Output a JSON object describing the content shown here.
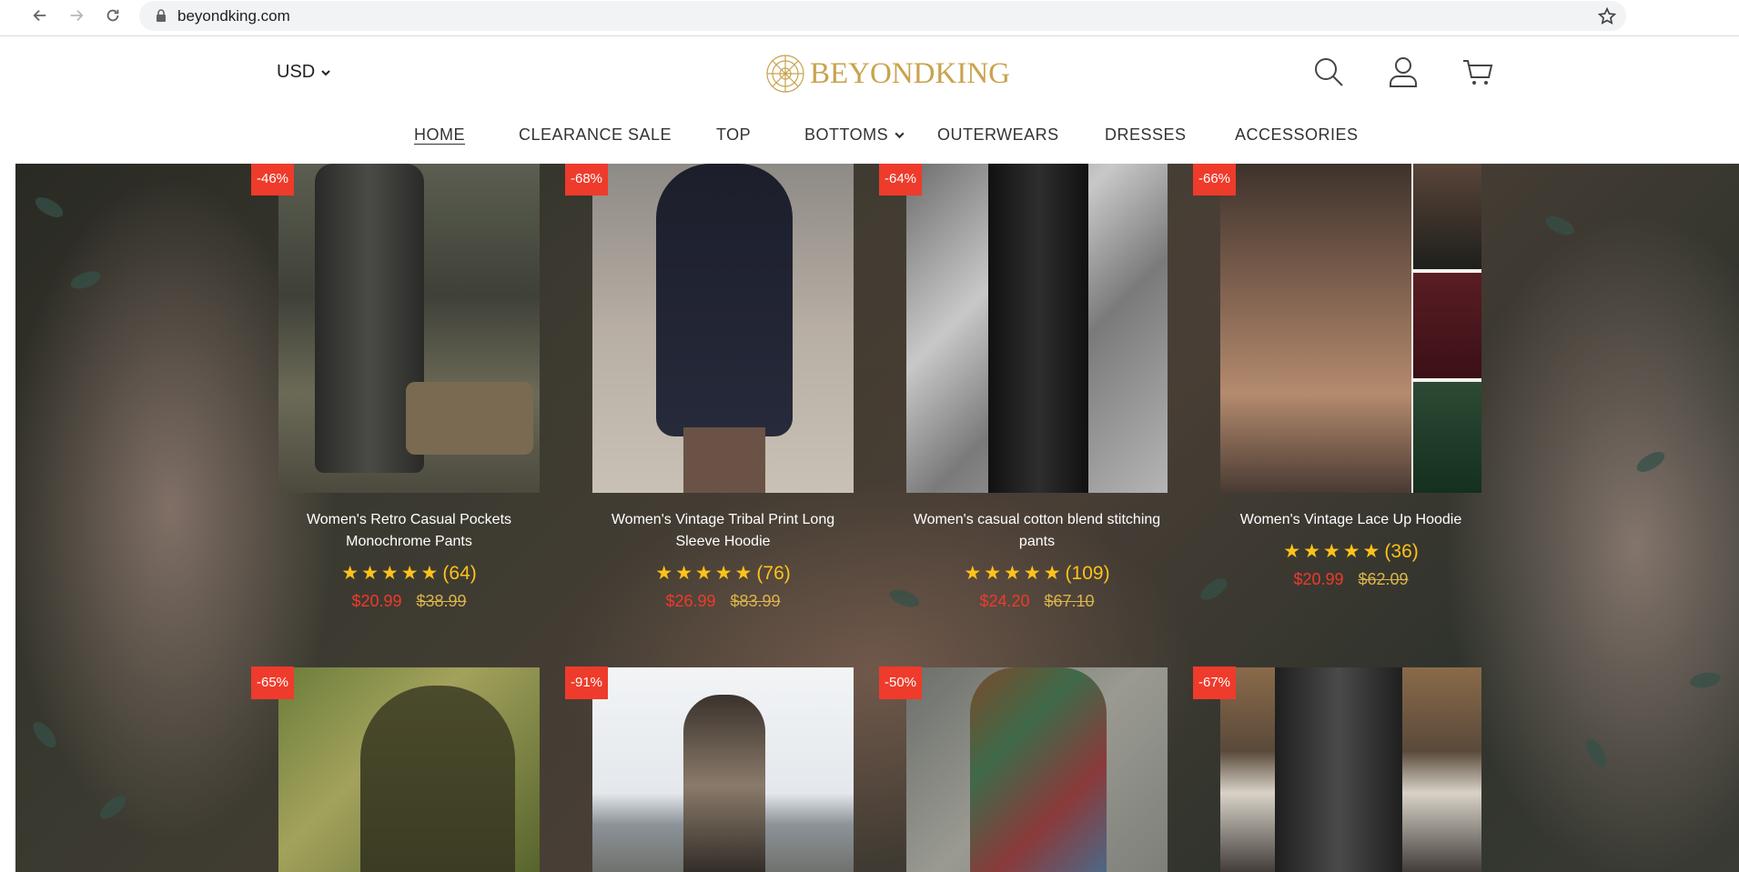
{
  "browser": {
    "url": "beyondking.com"
  },
  "header": {
    "currency": "USD",
    "logo_text": "BEYONDKING",
    "nav": [
      {
        "label": "HOME"
      },
      {
        "label": "CLEARANCE SALE"
      },
      {
        "label": "TOP"
      },
      {
        "label": "BOTTOMS"
      },
      {
        "label": "OUTERWEARS"
      },
      {
        "label": "DRESSES"
      },
      {
        "label": "ACCESSORIES"
      }
    ]
  },
  "colors": {
    "accent_gold": "#c9a34d",
    "sale_red": "#ee3b2b",
    "star_yellow": "#ffc21a"
  },
  "products": [
    {
      "badge": "-46%",
      "title": "Women's Retro Casual Pockets Monochrome Pants",
      "stars": "★★★★★",
      "rating_count": "(64)",
      "price": "$20.99",
      "old_price": "$38.99"
    },
    {
      "badge": "-68%",
      "title": "Women's Vintage Tribal Print Long Sleeve Hoodie",
      "stars": "★★★★★",
      "rating_count": "(76)",
      "price": "$26.99",
      "old_price": "$83.99"
    },
    {
      "badge": "-64%",
      "title": "Women's casual cotton blend stitching pants",
      "stars": "★★★★★",
      "rating_count": "(109)",
      "price": "$24.20",
      "old_price": "$67.10"
    },
    {
      "badge": "-66%",
      "title": "Women's Vintage Lace Up Hoodie",
      "stars": "★★★★★",
      "rating_count": "(36)",
      "price": "$20.99",
      "old_price": "$62.09"
    },
    {
      "badge": "-65%"
    },
    {
      "badge": "-91%"
    },
    {
      "badge": "-50%"
    },
    {
      "badge": "-67%"
    }
  ]
}
